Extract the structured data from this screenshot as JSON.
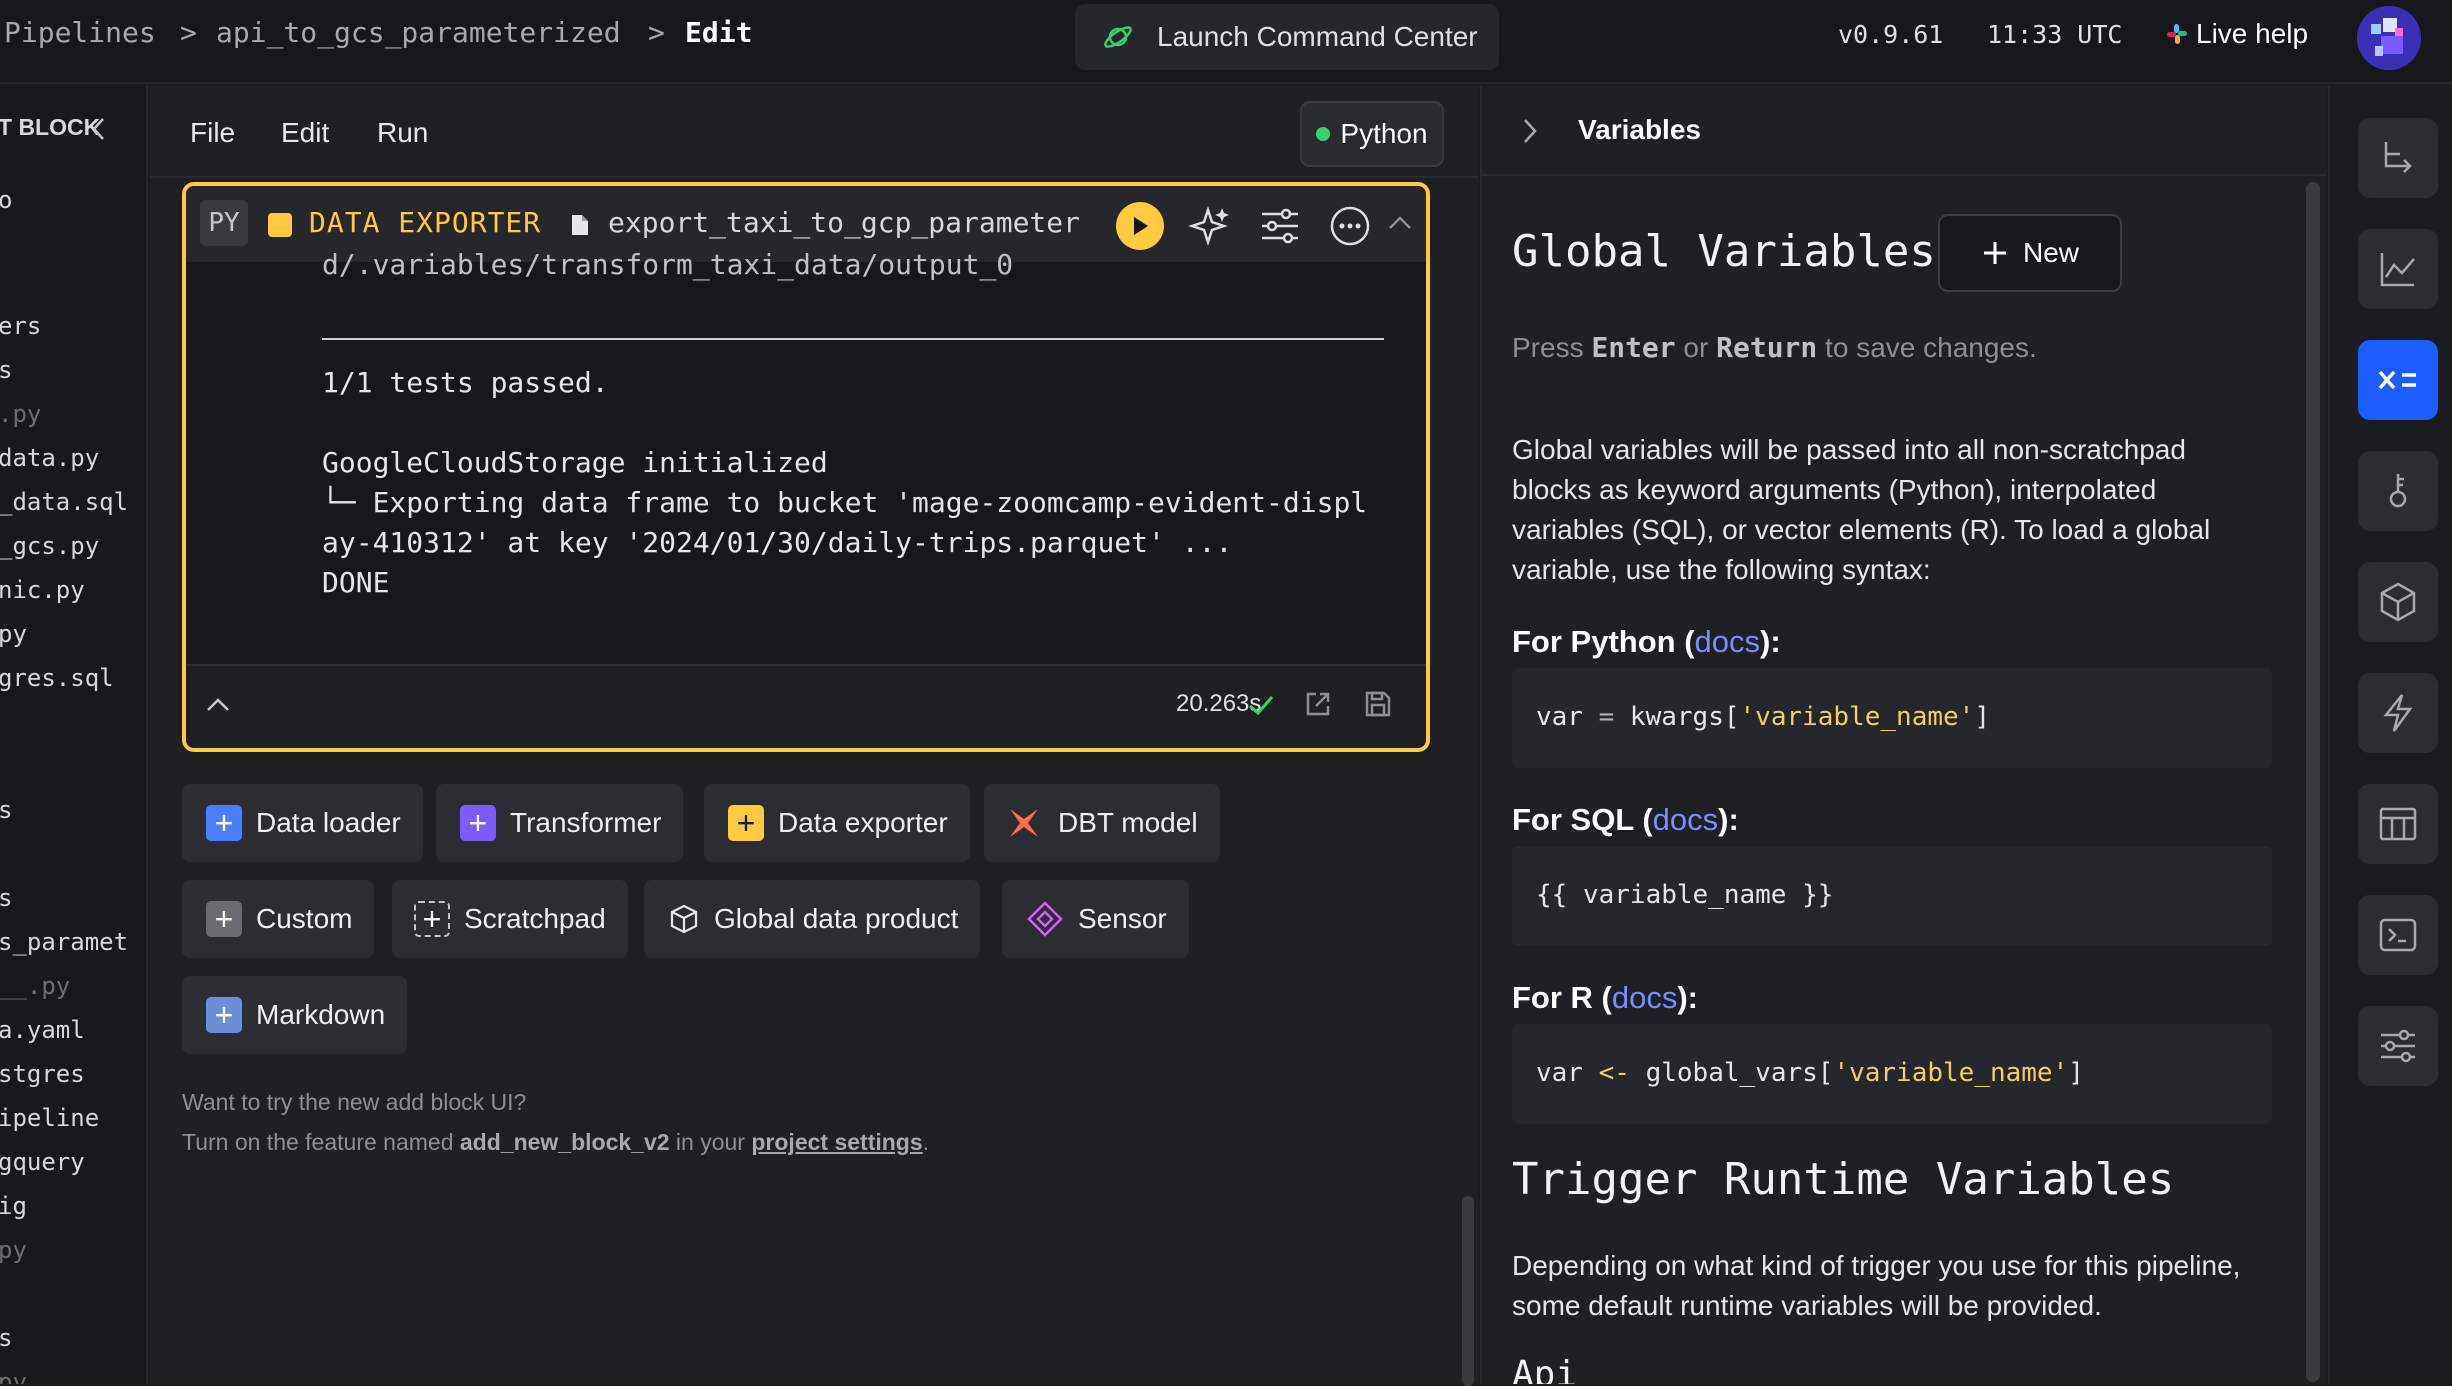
{
  "breadcrumb": {
    "root": "Pipelines",
    "pipeline": "api_to_gcs_parameterized",
    "current": "Edit",
    "sep": ">"
  },
  "header": {
    "launch_label": "Launch Command Center",
    "version": "v0.9.61",
    "time": "11:33 UTC",
    "live_help": "Live help"
  },
  "left_pane": {
    "title": "T BLOCK",
    "files": [
      "o",
      "ers",
      "s",
      ".py",
      "data.py",
      "_data.sql",
      "_gcs.py",
      "nic.py",
      "py",
      "gres.sql",
      "s",
      "s",
      "s_paramet",
      "__.py",
      "a.yaml",
      "stgres",
      "ipeline",
      "gquery",
      "ig",
      "py",
      "s",
      "py"
    ]
  },
  "menubar": {
    "file": "File",
    "edit": "Edit",
    "run": "Run",
    "language": "Python"
  },
  "block": {
    "badge": "PY",
    "type": "DATA EXPORTER",
    "filename": "export_taxi_to_gcp_parameter",
    "output": {
      "clipped_line": "d/.variables/transform_taxi_data/output_0",
      "tests": "1/1 tests passed.",
      "gcs_init": "GoogleCloudStorage initialized",
      "export_line1": "└─ Exporting data frame to bucket 'mage-zoomcamp-evident-displ",
      "export_line2": "ay-410312' at key '2024/01/30/daily-trips.parquet' ...",
      "done": "DONE"
    },
    "duration": "20.263s"
  },
  "add_blocks": {
    "data_loader": "Data loader",
    "transformer": "Transformer",
    "data_exporter": "Data exporter",
    "dbt_model": "DBT model",
    "custom": "Custom",
    "scratchpad": "Scratchpad",
    "global_data_product": "Global data product",
    "sensor": "Sensor",
    "markdown": "Markdown"
  },
  "hint": {
    "line1": "Want to try the new add block UI?",
    "line2_pre": "Turn on the feature named ",
    "feature": "add_new_block_v2",
    "line2_mid": " in your ",
    "link": "project settings",
    "line2_end": "."
  },
  "variables_panel": {
    "title": "Variables",
    "global_heading": "Global Variables",
    "new_button": "New",
    "press_pre": "Press ",
    "enter": "Enter",
    "or": " or ",
    "return": "Return",
    "press_post": " to save changes.",
    "description": "Global variables will be passed into all non-scratchpad blocks as keyword arguments (Python), interpolated variables (SQL), or vector elements (R). To load a global variable, use the following syntax:",
    "python_heading": "For Python (",
    "sql_heading": "For SQL (",
    "r_heading": "For R (",
    "docs": "docs",
    "heading_close": "):",
    "python_code_pre": "var ",
    "python_code_op": "=",
    "python_code_mid": " kwargs[",
    "python_code_str": "'variable_name'",
    "python_code_end": "]",
    "sql_code": "{{ variable_name }}",
    "r_code_pre": "var ",
    "r_code_op": "<-",
    "r_code_mid": " global_vars[",
    "r_code_str": "'variable_name'",
    "r_code_end": "]",
    "trigger_heading": "Trigger Runtime Variables",
    "trigger_desc": "Depending on what kind of trigger you use for this pipeline, some default runtime variables will be provided.",
    "api_heading": "Api"
  },
  "colors": {
    "exporter": "#ffc940",
    "loader": "#4a7dff",
    "transformer": "#7c5cff",
    "dbt": "#fc6d4a",
    "sensor": "#d65cff",
    "accent": "#1d5cff"
  }
}
